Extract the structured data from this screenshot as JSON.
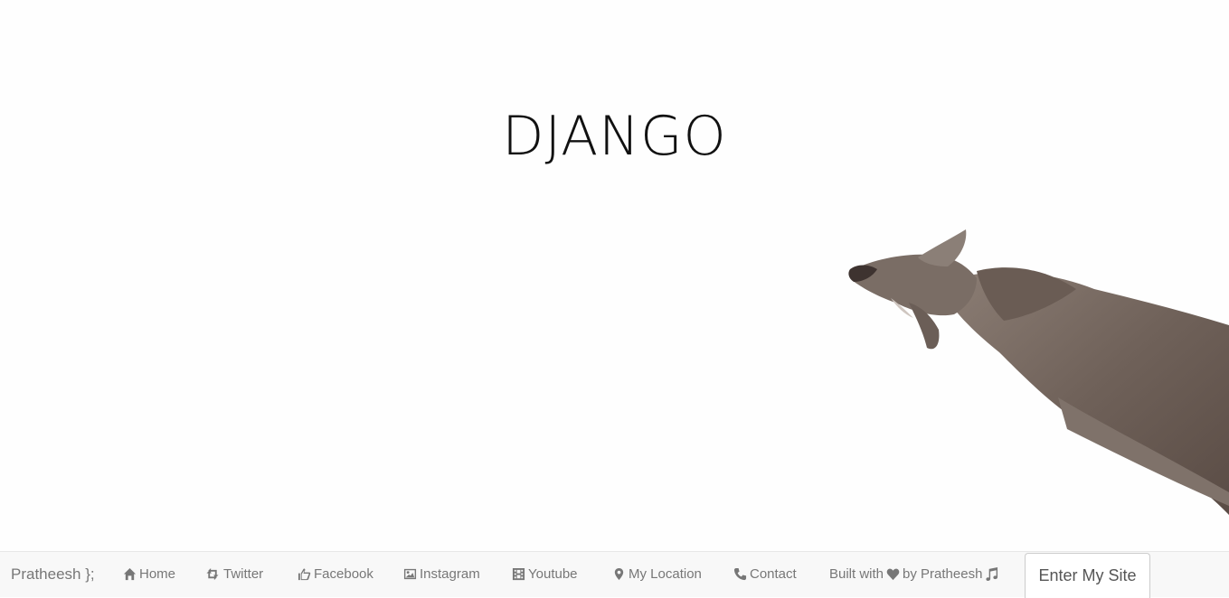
{
  "hero": {
    "title": "DJANGO"
  },
  "navbar": {
    "brand": "Pratheesh };",
    "items": [
      {
        "label": "Home",
        "icon": "home-icon"
      },
      {
        "label": "Twitter",
        "icon": "retweet-icon"
      },
      {
        "label": "Facebook",
        "icon": "thumbs-up-icon"
      },
      {
        "label": "Instagram",
        "icon": "picture-icon"
      },
      {
        "label": "Youtube",
        "icon": "film-icon"
      },
      {
        "label": "My Location",
        "icon": "map-marker-icon"
      },
      {
        "label": "Contact",
        "icon": "phone-icon"
      }
    ],
    "credit": {
      "prefix": "Built with",
      "suffix": "by Pratheesh"
    },
    "enter_button": "Enter My Site"
  },
  "colors": {
    "background": "#fefefe",
    "navbar": "#f8f8f8",
    "nav_text": "#777777",
    "title": "#111111"
  }
}
